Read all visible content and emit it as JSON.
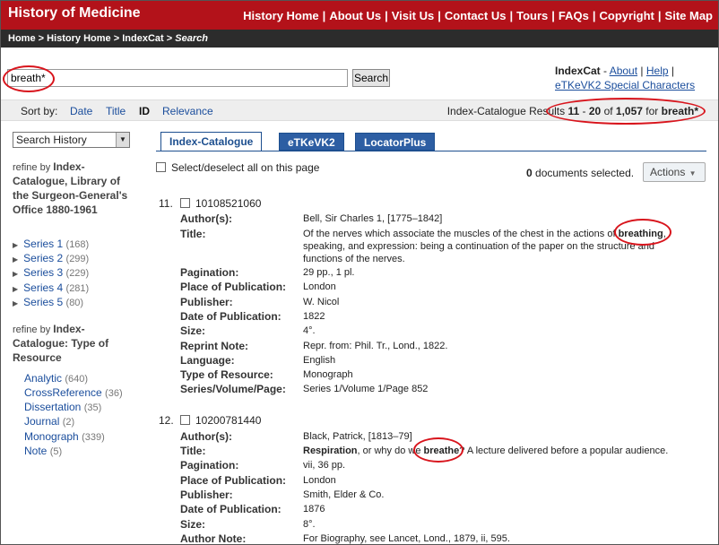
{
  "header": {
    "site_title": "History of Medicine",
    "nav": [
      "History Home",
      "About Us",
      "Visit Us",
      "Contact Us",
      "Tours",
      "FAQs",
      "Copyright",
      "Site Map"
    ],
    "nav_sep": "|"
  },
  "breadcrumb": {
    "home": "Home",
    "sep": ">",
    "history_home": "History Home",
    "indexcat": "IndexCat",
    "current": "Search"
  },
  "search": {
    "query": "breath*",
    "button_label": "Search"
  },
  "side_info": {
    "app_name": "IndexCat",
    "dash": "-",
    "about": "About",
    "sep": "|",
    "help": "Help",
    "special_chars": "eTKeVK2 Special Characters"
  },
  "sort": {
    "label": "Sort by:",
    "options": [
      "Date",
      "Title",
      "ID",
      "Relevance"
    ],
    "current": "ID"
  },
  "results_summary": {
    "prefix": "Index-Catalogue Results",
    "from": "11",
    "dash": "-",
    "to": "20",
    "of": "of",
    "total": "1,057",
    "for": "for",
    "term": "breath*"
  },
  "sidebar": {
    "history_select": "Search History",
    "refine1_prefix": "refine by",
    "refine1_title": "Index-Catalogue, Library of the Surgeon-General's Office 1880-1961",
    "series": [
      {
        "label": "Series 1",
        "count": "(168)"
      },
      {
        "label": "Series 2",
        "count": "(299)"
      },
      {
        "label": "Series 3",
        "count": "(229)"
      },
      {
        "label": "Series 4",
        "count": "(281)"
      },
      {
        "label": "Series 5",
        "count": "(80)"
      }
    ],
    "refine2_prefix": "refine by",
    "refine2_title": "Index-Catalogue: Type of Resource",
    "types": [
      {
        "label": "Analytic",
        "count": "(640)"
      },
      {
        "label": "CrossReference",
        "count": "(36)"
      },
      {
        "label": "Dissertation",
        "count": "(35)"
      },
      {
        "label": "Journal",
        "count": "(2)"
      },
      {
        "label": "Monograph",
        "count": "(339)"
      },
      {
        "label": "Note",
        "count": "(5)"
      }
    ]
  },
  "tabs": [
    "Index-Catalogue",
    "eTKeVK2",
    "LocatorPlus"
  ],
  "list_controls": {
    "select_all": "Select/deselect all on this page",
    "selected_count": "0",
    "selected_suffix": "documents selected.",
    "actions": "Actions"
  },
  "records": [
    {
      "num": "11.",
      "id": "10108521060",
      "fields": [
        {
          "label": "Author(s):",
          "value": "Bell, Sir Charles 1, [1775–1842]"
        },
        {
          "label": "Title:",
          "pre": "Of the nerves which associate the muscles of the chest in the actions of ",
          "hit": "breathing",
          "post": ", speaking, and expression: being a continuation of the paper on the structure and functions of the nerves."
        },
        {
          "label": "Pagination:",
          "value": "29 pp., 1 pl."
        },
        {
          "label": "Place of Publication:",
          "value": "London"
        },
        {
          "label": "Publisher:",
          "value": "W. Nicol"
        },
        {
          "label": "Date of Publication:",
          "value": "1822"
        },
        {
          "label": "Size:",
          "value": "4°."
        },
        {
          "label": "Reprint Note:",
          "value": "Repr. from: Phil. Tr., Lond., 1822."
        },
        {
          "label": "Language:",
          "value": "English"
        },
        {
          "label": "Type of Resource:",
          "value": "Monograph"
        },
        {
          "label": "Series/Volume/Page:",
          "value": "Series 1/Volume 1/Page 852"
        }
      ]
    },
    {
      "num": "12.",
      "id": "10200781440",
      "fields": [
        {
          "label": "Author(s):",
          "value": "Black, Patrick, [1813–79]"
        },
        {
          "label": "Title:",
          "hit1": "Respiration",
          "mid": ", or why do we ",
          "hit2": "breathe",
          "post": "? A lecture delivered before a popular audience."
        },
        {
          "label": "Pagination:",
          "value": "vii, 36 pp."
        },
        {
          "label": "Place of Publication:",
          "value": "London"
        },
        {
          "label": "Publisher:",
          "value": "Smith, Elder & Co."
        },
        {
          "label": "Date of Publication:",
          "value": "1876"
        },
        {
          "label": "Size:",
          "value": "8°."
        },
        {
          "label": "Author Note:",
          "value": "For Biography, see Lancet, Lond., 1879, ii, 595."
        }
      ]
    }
  ],
  "colors": {
    "header_red": "#b3121a",
    "breadcrumb_bg": "#2c2c2c",
    "link_blue": "#1a4d9c",
    "tab_blue": "#2d5ea3",
    "annotation_red": "#d8141c"
  }
}
